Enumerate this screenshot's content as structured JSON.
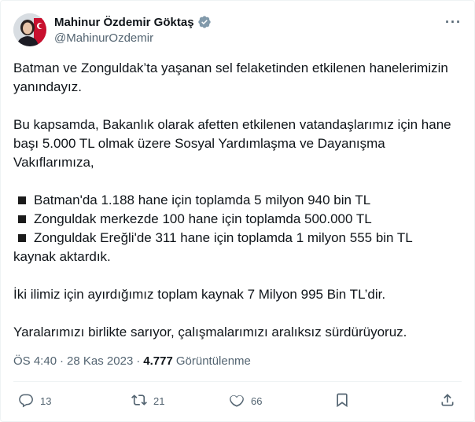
{
  "author": {
    "display_name": "Mahinur Özdemir Göktaş",
    "handle": "@MahinurOzdemir"
  },
  "more_label": "···",
  "tweet": {
    "para1": "Batman ve Zonguldak’ta yaşanan sel felaketinden etkilenen hanelerimizin yanındayız.",
    "para2": "Bu kapsamda, Bakanlık olarak afetten etkilenen vatandaşlarımız için hane başı 5.000 TL olmak üzere Sosyal Yardımlaşma ve Dayanışma Vakıflarımıza,",
    "bullets": [
      "Batman'da 1.188 hane için toplamda 5 milyon 940 bin TL",
      "Zonguldak merkezde 100 hane için toplamda 500.000 TL",
      "Zonguldak Ereğli'de 311 hane için toplamda 1 milyon 555 bin TL"
    ],
    "bullets_tail": "kaynak aktardık.",
    "para3": "İki ilimiz için ayırdığımız toplam kaynak 7 Milyon 995 Bin TL’dir.",
    "para4": "Yaralarımızı birlikte sarıyor, çalışmalarımızı aralıksız sürdürüyoruz."
  },
  "meta": {
    "time": "ÖS 4:40",
    "separator": "·",
    "date": "28 Kas 2023",
    "separator2": "·",
    "views_count": "4.777",
    "views_label": "Görüntülenme"
  },
  "actions": {
    "reply_count": "13",
    "retweet_count": "21",
    "like_count": "66"
  },
  "colors": {
    "text": "#0f1419",
    "secondary": "#536471",
    "verified": "#829aab",
    "divider": "#eff3f4"
  },
  "icons": [
    "verified-badge-icon",
    "more-icon",
    "reply-icon",
    "retweet-icon",
    "like-icon",
    "bookmark-icon",
    "share-icon"
  ]
}
